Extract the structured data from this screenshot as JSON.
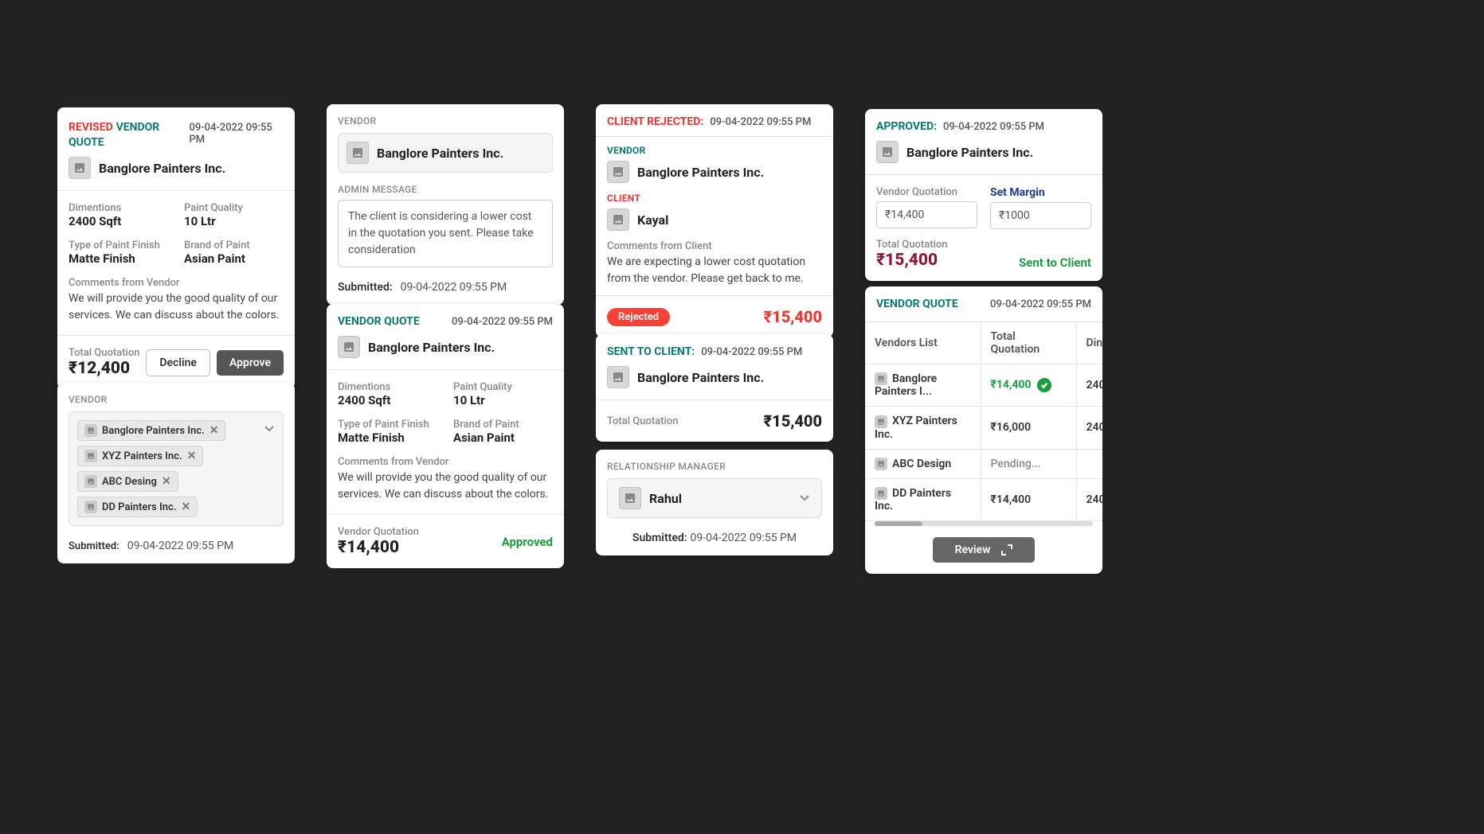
{
  "timestamp": "09-04-2022 09:55 PM",
  "labels": {
    "vendor": "VENDOR",
    "client": "CLIENT",
    "admin_message": "ADMIN MESSAGE",
    "dimensions": "Dimentions",
    "paint_quality": "Paint Quality",
    "paint_finish": "Type of Paint Finish",
    "paint_brand": "Brand of Paint",
    "comments_vendor": "Comments from Vendor",
    "comments_client": "Comments from Client",
    "total_quotation": "Total Quotation",
    "vendor_quotation": "Vendor Quotation",
    "set_margin": "Set Margin",
    "submitted": "Submitted:",
    "vendors_list": "Vendors List",
    "relationship_manager": "RELATIONSHIP MANAGER",
    "dimensions_short": "Din"
  },
  "card1": {
    "title_prefix": "REVISED",
    "title_main": "VENDOR QUOTE",
    "vendor_name": "Banglore Painters Inc.",
    "dimensions": "2400 Sqft",
    "paint_quality": "10 Ltr",
    "paint_finish": "Matte Finish",
    "paint_brand": "Asian Paint",
    "comments": "We will provide you the good quality of our services. We can discuss about the colors.",
    "total": "₹12,400",
    "btn_decline": "Decline",
    "btn_approve": "Approve"
  },
  "card2": {
    "chips": [
      "Banglore Painters Inc.",
      "XYZ Painters Inc.",
      "ABC Desing",
      "DD Painters Inc."
    ]
  },
  "card3": {
    "vendor_name": "Banglore Painters Inc.",
    "admin_message": "The client is considering a lower cost in the quotation you sent. Please take consideration"
  },
  "card4": {
    "title": "VENDOR QUOTE",
    "vendor_name": "Banglore Painters Inc.",
    "dimensions": "2400 Sqft",
    "paint_quality": "10 Ltr",
    "paint_finish": "Matte Finish",
    "paint_brand": "Asian Paint",
    "comments": "We will provide you the good quality of our services. We can discuss about the colors.",
    "vendor_quotation": "₹14,400",
    "status": "Approved"
  },
  "card5": {
    "title": "CLIENT REJECTED:",
    "vendor_name": "Banglore Painters Inc.",
    "client_name": "Kayal",
    "comments": "We are expecting a lower cost quotation from the vendor. Please get back to me.",
    "badge": "Rejected",
    "amount": "₹15,400"
  },
  "card6": {
    "title": "SENT TO CLIENT:",
    "vendor_name": "Banglore Painters Inc.",
    "amount": "₹15,400"
  },
  "card7": {
    "manager_name": "Rahul"
  },
  "card8": {
    "title": "APPROVED:",
    "vendor_name": "Banglore Painters Inc.",
    "vendor_quotation_val": "₹14,400",
    "margin_val": "₹1000",
    "total": "₹15,400",
    "status": "Sent to Client"
  },
  "card9": {
    "title": "VENDOR QUOTE",
    "rows": [
      {
        "name": "Banglore Painters I...",
        "quote": "₹14,400",
        "check": true,
        "dim": "240"
      },
      {
        "name": "XYZ Painters Inc.",
        "quote": "₹16,000",
        "check": false,
        "dim": "240"
      },
      {
        "name": "ABC Design",
        "quote": "Pending...",
        "check": false,
        "dim": ""
      },
      {
        "name": "DD Painters Inc.",
        "quote": "₹14,400",
        "check": false,
        "dim": "240"
      }
    ],
    "btn_review": "Review"
  }
}
